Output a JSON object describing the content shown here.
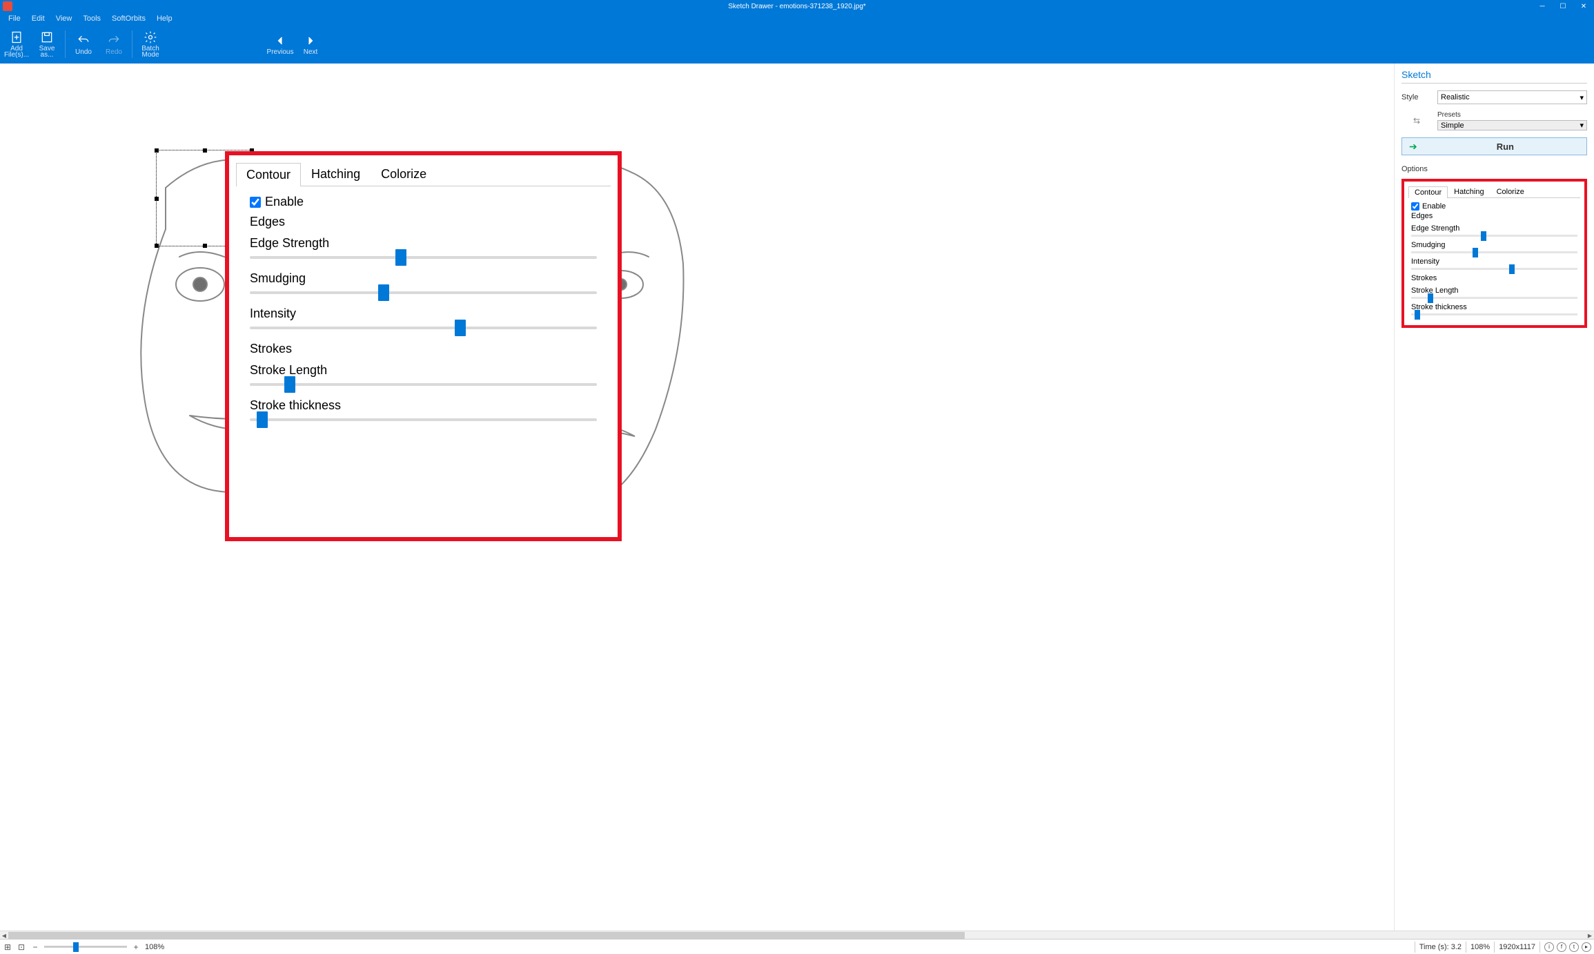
{
  "titlebar": {
    "title": "Sketch Drawer - emotions-371238_1920.jpg*"
  },
  "menu": {
    "file": "File",
    "edit": "Edit",
    "view": "View",
    "tools": "Tools",
    "softorbits": "SoftOrbits",
    "help": "Help"
  },
  "toolbar": {
    "add_files": "Add\nFile(s)...",
    "save_as": "Save\nas...",
    "undo": "Undo",
    "redo": "Redo",
    "batch_mode": "Batch\nMode",
    "previous": "Previous",
    "next": "Next"
  },
  "overlay": {
    "tabs": {
      "contour": "Contour",
      "hatching": "Hatching",
      "colorize": "Colorize"
    },
    "enable": "Enable",
    "edges_section": "Edges",
    "edge_strength": "Edge Strength",
    "smudging": "Smudging",
    "intensity": "Intensity",
    "strokes_section": "Strokes",
    "stroke_length": "Stroke Length",
    "stroke_thickness": "Stroke thickness",
    "slider_values": {
      "edge_strength": 42,
      "smudging": 37,
      "intensity": 59,
      "stroke_length": 10,
      "stroke_thickness": 2
    }
  },
  "side": {
    "title": "Sketch",
    "style_label": "Style",
    "style_value": "Realistic",
    "presets_label": "Presets",
    "presets_value": "Simple",
    "run": "Run",
    "options_label": "Options",
    "tabs": {
      "contour": "Contour",
      "hatching": "Hatching",
      "colorize": "Colorize"
    },
    "enable": "Enable",
    "edges_section": "Edges",
    "edge_strength": "Edge Strength",
    "smudging": "Smudging",
    "intensity": "Intensity",
    "strokes_section": "Strokes",
    "stroke_length": "Stroke Length",
    "stroke_thickness": "Stroke thickness",
    "slider_values": {
      "edge_strength": 42,
      "smudging": 37,
      "intensity": 59,
      "stroke_length": 10,
      "stroke_thickness": 2
    }
  },
  "status": {
    "zoom_pct": "108%",
    "zoom_slider": 35,
    "time_label": "Time (s): 3.2",
    "zoom_pct2": "108%",
    "dimensions": "1920x1117"
  }
}
